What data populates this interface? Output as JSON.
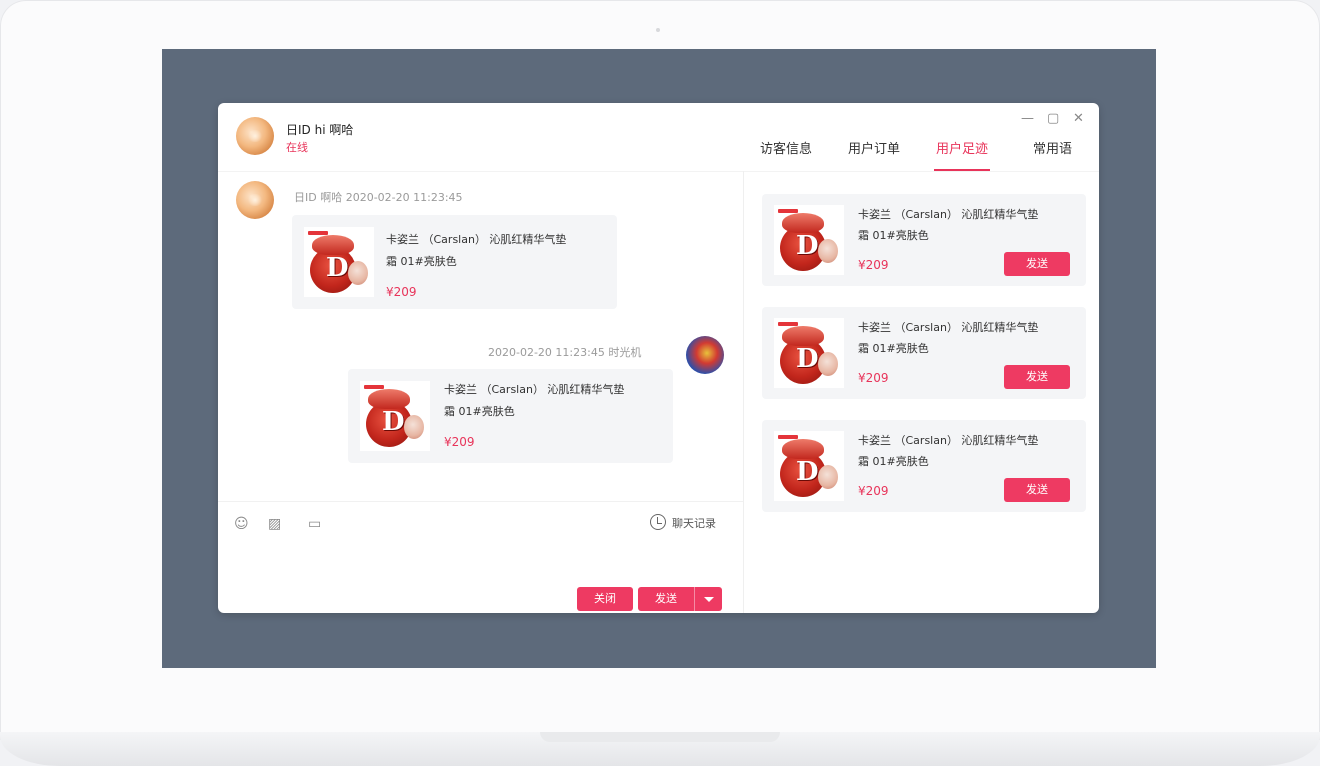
{
  "header": {
    "name": "日ID hi 啊哈",
    "status": "在线",
    "controls": [
      "—",
      "▢",
      "✕"
    ]
  },
  "tabs": [
    {
      "label": "访客信息",
      "active": false
    },
    {
      "label": "用户订单",
      "active": false
    },
    {
      "label": "用户足迹",
      "active": true
    },
    {
      "label": "常用语",
      "active": false
    }
  ],
  "messages": [
    {
      "meta": "日ID 啊哈   2020-02-20  11:23:45",
      "product": {
        "title": "卡姿兰 （Carslan） 沁肌红精华气垫",
        "sku": "霜 01#亮肤色",
        "price": "¥209"
      }
    },
    {
      "meta": "2020-02-20  11:23:45   时光机",
      "product": {
        "title": "卡姿兰 （Carslan） 沁肌红精华气垫",
        "sku": "霜 01#亮肤色",
        "price": "¥209"
      }
    }
  ],
  "footprints": [
    {
      "title": "卡姿兰 （Carslan） 沁肌红精华气垫",
      "sku": "霜 01#亮肤色",
      "price": "¥209",
      "button": "发送"
    },
    {
      "title": "卡姿兰 （Carslan） 沁肌红精华气垫",
      "sku": "霜 01#亮肤色",
      "price": "¥209",
      "button": "发送"
    },
    {
      "title": "卡姿兰 （Carslan） 沁肌红精华气垫",
      "sku": "霜 01#亮肤色",
      "price": "¥209",
      "button": "发送"
    }
  ],
  "toolbar": {
    "history_label": "聊天记录",
    "close_label": "关闭",
    "send_label": "发送"
  },
  "colors": {
    "accent": "#ee3a62",
    "backdrop": "#5d6a7b"
  },
  "icons": [
    "emoji-icon",
    "image-icon",
    "folder-icon",
    "clock-icon",
    "chevron-down-icon"
  ]
}
